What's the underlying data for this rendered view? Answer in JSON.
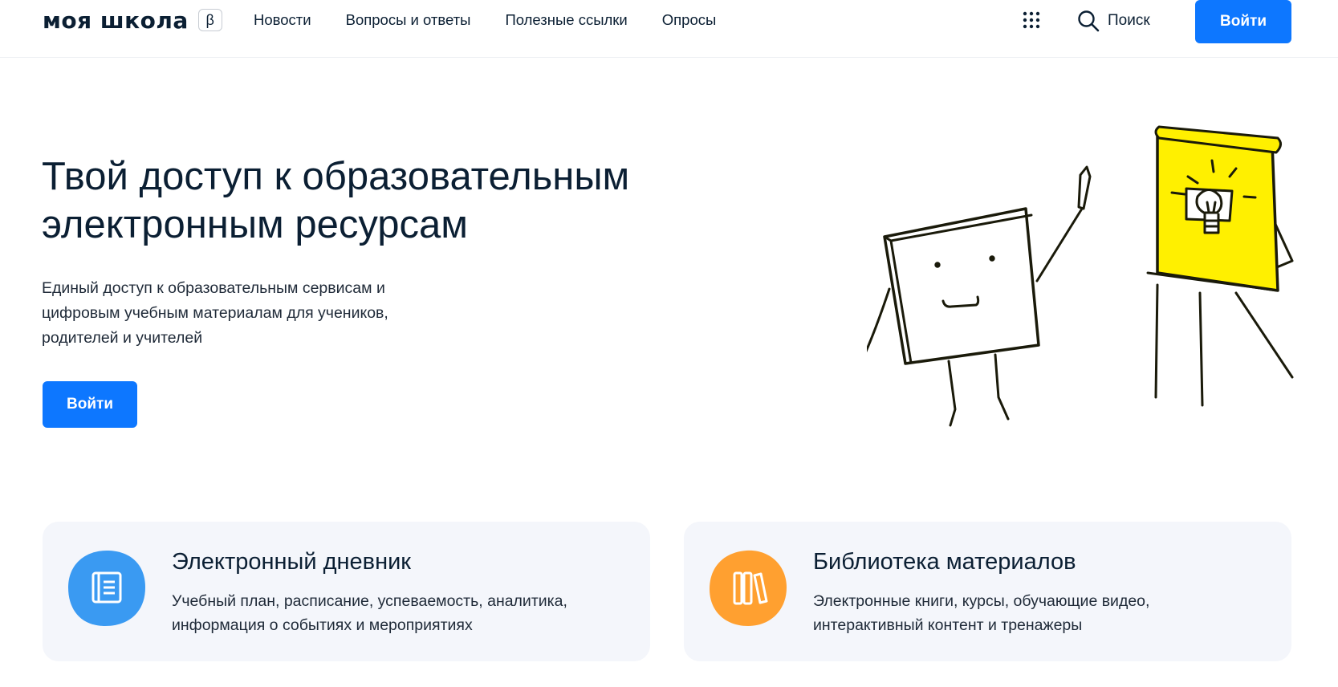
{
  "header": {
    "logo": "моя школа",
    "beta": "β",
    "nav": [
      "Новости",
      "Вопросы и ответы",
      "Полезные ссылки",
      "Опросы"
    ],
    "search_label": "Поиск",
    "login_label": "Войти"
  },
  "hero": {
    "title": "Твой доступ к образовательным электронным ресурсам",
    "subtitle": "Единый доступ к образовательным сервисам и цифровым учебным материалам для учеников, родителей и учителей",
    "login_label": "Войти"
  },
  "cards": [
    {
      "title": "Электронный дневник",
      "description": "Учебный план, расписание, успеваемость, аналитика, информация о событиях и мероприятиях",
      "icon": "diary-icon",
      "color": "#3a9af2"
    },
    {
      "title": "Библиотека материалов",
      "description": "Электронные книги, курсы, обучающие видео, интерактивный контент и тренажеры",
      "icon": "library-books-icon",
      "color": "#ffa030"
    }
  ],
  "colors": {
    "primary": "#0d77ff",
    "text": "#0b1f33",
    "card_bg": "#f4f6fb",
    "flipchart": "#fff000"
  }
}
